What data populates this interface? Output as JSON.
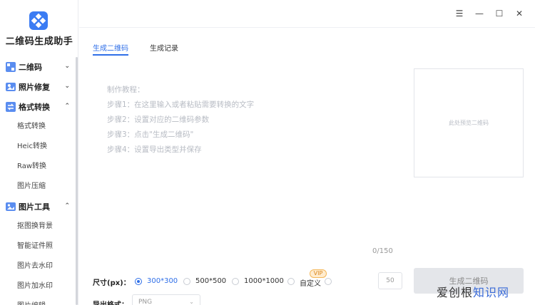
{
  "app": {
    "name": "二维码生成助手"
  },
  "sidebar": {
    "sections": [
      {
        "label": "二维码",
        "chevron": "⌄",
        "icon": "qrcode-icon"
      },
      {
        "label": "照片修复",
        "chevron": "⌄",
        "icon": "photo-repair-icon"
      },
      {
        "label": "格式转换",
        "chevron": "⌃",
        "icon": "format-convert-icon",
        "items": [
          "格式转换",
          "Heic转换",
          "Raw转换",
          "图片压缩"
        ]
      },
      {
        "label": "图片工具",
        "chevron": "⌃",
        "icon": "image-tools-icon",
        "items": [
          "抠图换背景",
          "智能证件照",
          "图片去水印",
          "图片加水印",
          "图片编辑"
        ]
      }
    ]
  },
  "titlebar": {
    "menu": "☰",
    "minimize": "—",
    "maximize": "☐",
    "close": "✕"
  },
  "tabs": [
    {
      "label": "生成二维码",
      "active": true
    },
    {
      "label": "生成记录",
      "active": false
    }
  ],
  "main": {
    "instructions": [
      "制作教程：",
      "步骤1：在这里输入或者粘贴需要转换的文字",
      "步骤2：设置对应的二维码参数",
      "步骤3：点击\"生成二维码\"",
      "步骤4：设置导出类型并保存"
    ],
    "counter": "0/150",
    "preview_placeholder": "此处预览二维码",
    "size_label": "尺寸(px)：",
    "size_options": [
      "300*300",
      "500*500",
      "1000*1000",
      "自定义"
    ],
    "size_selected": "300*300",
    "vip_badge": "VIP",
    "custom_size_value": "50",
    "generate_button": "生成二维码",
    "export_label": "导出格式：",
    "export_value": "PNG"
  },
  "watermark": {
    "text_part1": "爱创根",
    "text_part2": "知识网"
  },
  "colors": {
    "accent": "#2f6fe8",
    "logo": "#3b7cf3",
    "vip": "#f4b657"
  }
}
